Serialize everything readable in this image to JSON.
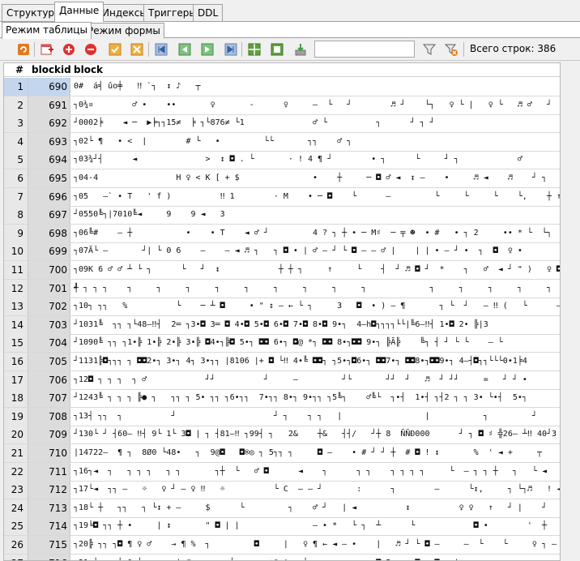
{
  "top_tabs": [
    "Структура",
    "Данные",
    "Индексы",
    "Триггеры",
    "DDL"
  ],
  "sub_tabs": [
    "Режим таблицы",
    "Режим формы"
  ],
  "toolbar": {
    "filter_placeholder": "",
    "total_rows": "Всего строк: 386",
    "icons": [
      "refresh-icon",
      "add-row-icon",
      "insert-row-icon",
      "delete-row-icon",
      "commit-icon",
      "rollback-icon",
      "first-icon",
      "prev-icon",
      "next-icon",
      "last-icon",
      "grid-icon-1",
      "grid-icon-2",
      "export-icon",
      "filter-icon",
      "clear-filter-icon"
    ]
  },
  "grid": {
    "headers": [
      "#",
      "blockid",
      "block"
    ],
    "rows": [
      {
        "n": "1",
        "id": "690",
        "block": "0#  á╡ ûo╪   ‼ `┐  ↕ ♪   ┬"
      },
      {
        "n": "2",
        "id": "691",
        "block": "┐0¾¤        ♂ •    ••       ♀       -      ♀     –  └   ┘        ♬ ┘    └┐   ♀ └ |   ♀ └   ♬ ♂   ┘"
      },
      {
        "n": "3",
        "id": "692",
        "block": "┘0002╞    ◄ ─  ▶╞┐┐15≠  ╞ ┐└876≠ └1              ♂ └          ┐      ┘ ┐ ┘"
      },
      {
        "n": "4",
        "id": "693",
        "block": "┐02└ ¶   • <  |        # └   •         └└       ┐┐    ♂ ┐"
      },
      {
        "n": "5",
        "id": "694",
        "block": "┐03¾┘┤      ◄              >  ↕ ◘ . └       · ! 4 ¶ ┘        • ┐      └     ┘ ┐            ♂        └"
      },
      {
        "n": "6",
        "id": "695",
        "block": "┐04-4                H ♀ < K [ + $               •    ┼     ─ ◘ ♂ ◄  ↕ –    •     ♬ ◄    ♬    ┘ ┐    ┘     ┘ ┐"
      },
      {
        "n": "7",
        "id": "696",
        "block": "┐05   –` • T   ' f )          ‼ 1        · M    • ─ ◘    └      –         └     └     └    └,    ┼ ↑"
      },
      {
        "n": "8",
        "id": "697",
        "block": "┘0550╚┐|7010╚◄     9    9 ◄   3"
      },
      {
        "n": "9",
        "id": "698",
        "block": "┐06╚#    – ┼           •    • T    ◄ ♂ ┘         4 ? ┐ ┼ • ─ M♯  ─ ╤ ☻  • #   • ┐ 2     •• * └  └┐    └♬"
      },
      {
        "n": "10",
        "id": "699",
        "block": "┐07Ã└ –       ┘| └ 0 6    –    – ◄ ♬ ┐   ┐ ◘ • | ♂ – ┘ └ ◘ – – ♂ |    | | • – ┘ •  ┐  ◘  ♀ •              !"
      },
      {
        "n": "11",
        "id": "700",
        "block": "┐09K 6 ♂ ♂ ┴ └ ┐      └   ┘  ↕            ┼ ┼ ┐     ↑     └    ┤  ┘ ♬ ◘ ┘  *    ┐   ♂  ◄ ┘ \" )   ♀ ◘     – %     • ♬     • ♬"
      },
      {
        "n": "12",
        "id": "701",
        "block": "╃ ┐ ┐ ┐    ┐     ┐     ┐     ┐     ┐     ┐     ┐     ┐     ┐             ┐     ┐     ┐     ┐     ┐     ┐"
      },
      {
        "n": "13",
        "id": "702",
        "block": "┐10┐ ┐┐   %          └    ─ ┴ ◘     • \" ↕ – ← └ ┐     3   ◘  • ) – ¶       ┐ └  ┘   – ‼ (   └      – └     – ☼      –┐"
      },
      {
        "n": "14",
        "id": "703",
        "block": "┘1031╚  ┐┐ ┐└48–‼┤  2═ ┐3•◘ 3═ ◘ 4•◘ 5•◘ 6•◘ 7•◘ 8•◘ 9•┐  4–h◘┐┐┐┐└└|╚6–‼┤ 1•◘ 2• ╠|3"
      },
      {
        "n": "15",
        "id": "704",
        "block": "┘1090╚ ┐┐ ┐1•╠ 1•╠ 2•╠ 3•╠ ◘4•┐╠◘ 5•┐ ◘◘ 6•┐ ◘@ *┐ ◘◘ 8•┐◘◘ 9•┐ ╠Ã╠    ╚┐ ┤ ┘ └ └    – └"
      },
      {
        "n": "16",
        "id": "705",
        "block": "┘1131╠◘┐┐┐ ┐ ◘◘2•┐ 3•┐ 4┐ 3•┐┐ |8106 |+ ◘ └‼ 4•╚ ◘◘┐ ┐5•┐◘6•┐ ◘◘7•┐ ◘◘8•┐◘◘9•┐ 4–┤◘┐┐└└└0•1╞4"
      },
      {
        "n": "17",
        "id": "706",
        "block": "┐12◘ ┐ ┐ ┐  ┐ ♂            ┘┘          ┘     –         ┘└       ┘┘  ┘   ♬  ┘ ┘┘     =   ┘ ┘ •         ♪"
      },
      {
        "n": "18",
        "id": "707",
        "block": "┘1243╚ ┐ ┐ ┐ ╠● ┐   ┐┐ ┐ 5• ┐┐ ┐6•┐┐  7•┐┐ 8•┐ 9•┐┐ ┐5╚┐    ♂╚└  ┐•┤  1•┤ ┐┤2 ┐ ┐ 3• └•┤  5•┐"
      },
      {
        "n": "19",
        "id": "708",
        "block": "┐13┤ ┐┐  ┐          ┘                    ┘ ┐    ┐ ┐   |                 |           ┐         ┘"
      },
      {
        "n": "20",
        "id": "709",
        "block": "┘130└ ┘ ┤60– ‼┤ 9└ 1└ 3◘ | ┐ ┤81–‼ ┐99┤ ┐   2&    ┼&   ┤┤/   ┘┼ 8  ÑÑÐ000      ┘ ┐ ◘ ♯ ╬26– ┴‼ 40┘3"
      },
      {
        "n": "21",
        "id": "710",
        "block": "|14722–  ¶ ┐  8Ø0 └48•   ┐  9@◘   ◘®◎ ┐ 5┐┐ ┐     ◘ –    • # ┘ ┘ ┼  # ◘ ! ↕       %  ' ◄ +     ┬    ‼"
      },
      {
        "n": "22",
        "id": "711",
        "block": "┐16┐◄  ┐   ┐ ┐ ┐   ┐ ┐       ┐┼  └   ♂ ◘      ◄    ┐      ┐ ┐    ┐ ┐ ┐ ┐     └  – ┐ ┐ ┼   ┐   └ ◄   ┘  –"
      },
      {
        "n": "23",
        "id": "712",
        "block": "┐17└◄  ┐┐ –   ☼   ♀ ┘ – ♀ ‼   ☼          └ C  – – ┘       :      ┐        –      └↕,     ┐ └┐♬   ! ◄┐"
      },
      {
        "n": "24",
        "id": "713",
        "block": "┐18└ ┼   ┐┐   ┐ └↕ + –     $      └         ┐    ♂ ┘   | ◄          ↕          ♀ ♀   ↑   ┘ |    ┘      ' • ♬ ┐ ┼ ◘ ┘"
      },
      {
        "n": "25",
        "id": "714",
        "block": "┐19╘◘ ┐┐ ┼ •     | ↕       \" ◘ | |               – • *   └ ┐  ┴      └            ◘ •        '  ┼     ┐ ' ◘ •"
      },
      {
        "n": "26",
        "id": "715",
        "block": "┐20╠ ┐┐ ┐◘ ¶ ♀ ♂    → ¶ %  ┐         ◘     |   ♀ ¶ ← ◄ – •    |   ♬ ┘ └ ◘ –     –  └    └     ♀ ┐ – |     –"
      },
      {
        "n": "27",
        "id": "716",
        "block": "┐21┐┴ ┐┐ └ 0 └ ┐   ┐ | ♬      ─ ┴       ☼\" ! ◄ ┘ ┐  ┐   ┐     ◘ 5 • – ◘ – ◘ – | ┐ ┐"
      }
    ]
  }
}
